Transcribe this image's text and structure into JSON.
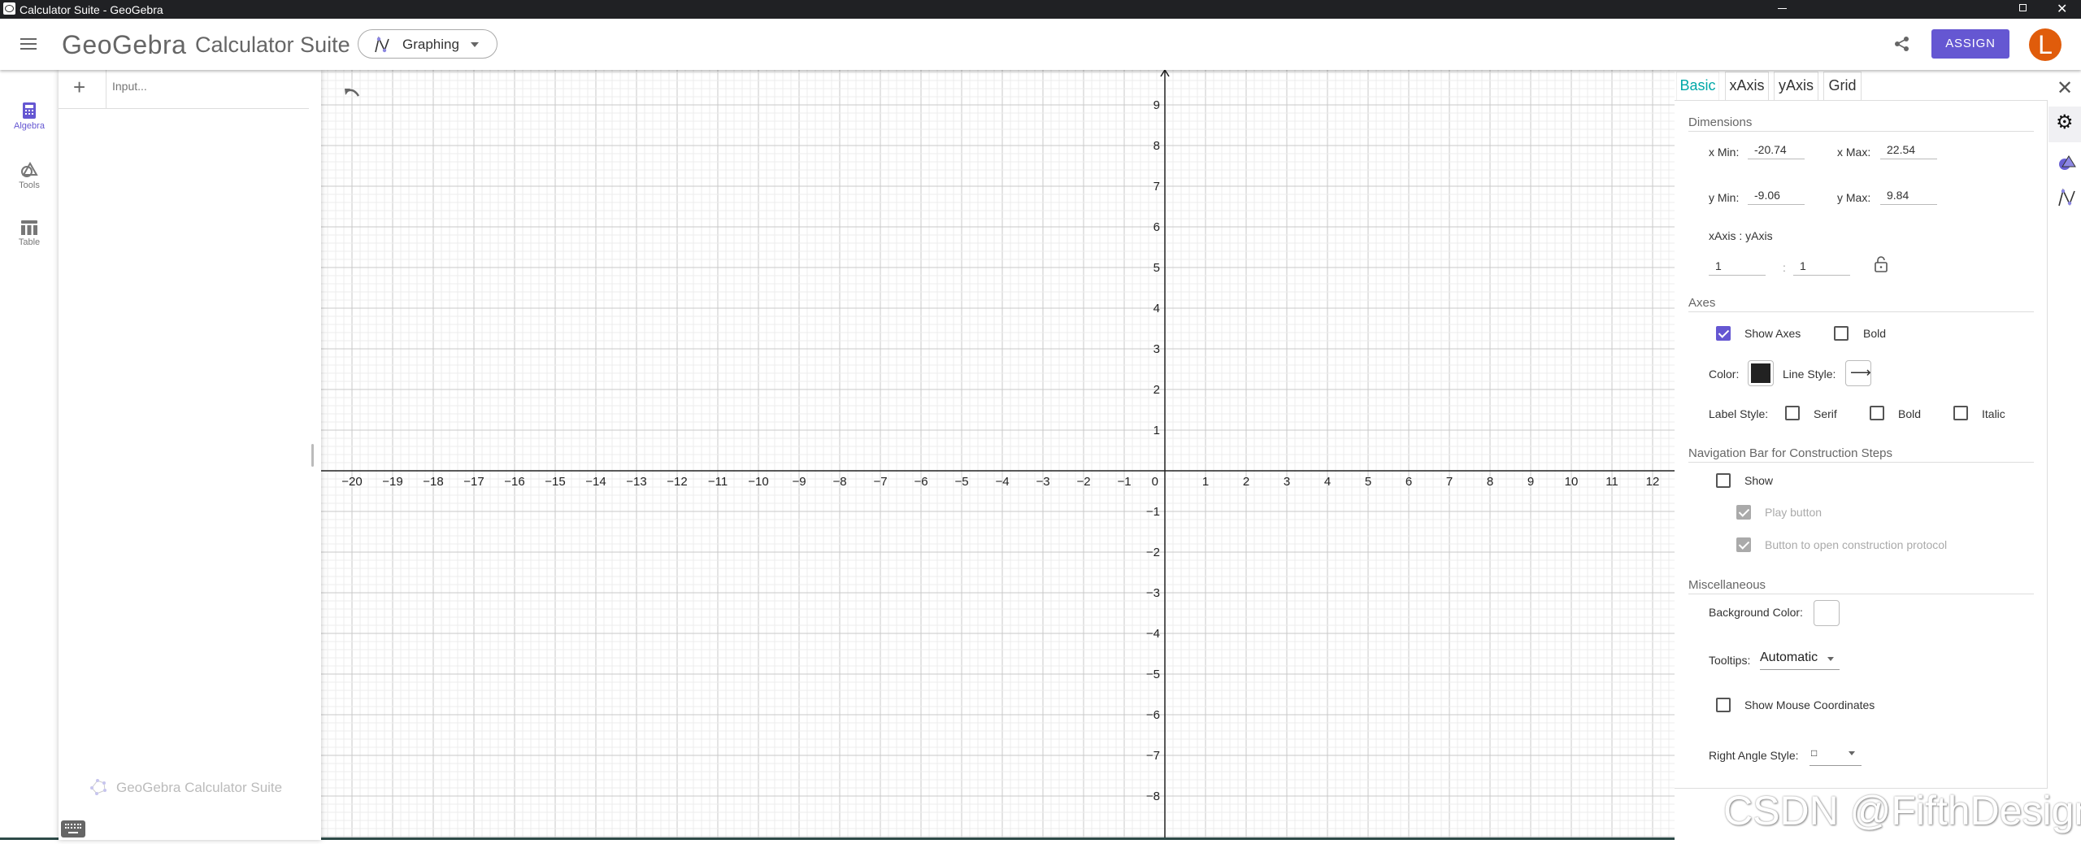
{
  "window": {
    "title": "Calculator Suite - GeoGebra"
  },
  "header": {
    "logo": "GeoGebra",
    "app_name": "Calculator Suite",
    "mode": "Graphing",
    "assign_label": "ASSIGN",
    "avatar_initial": "L",
    "accent": "#6557d2",
    "avatar_color": "#e05c0b"
  },
  "nav": {
    "items": [
      {
        "label": "Algebra",
        "active": true
      },
      {
        "label": "Tools"
      },
      {
        "label": "Table"
      }
    ]
  },
  "algebra": {
    "input_placeholder": "Input...",
    "footer": "GeoGebra Calculator Suite"
  },
  "graphics": {
    "x_ticks": [
      -20,
      -19,
      -18,
      -17,
      -16,
      -15,
      -14,
      -13,
      -12,
      -11,
      -10,
      -9,
      -8,
      -7,
      -6,
      -5,
      -4,
      -3,
      -2,
      -1,
      1,
      2,
      3,
      4,
      5,
      6,
      7,
      8,
      9,
      10,
      11,
      12
    ],
    "y_ticks": [
      -8,
      -7,
      -6,
      -5,
      -4,
      -3,
      -2,
      -1,
      1,
      2,
      3,
      4,
      5,
      6,
      7,
      8,
      9
    ],
    "origin_label": "0"
  },
  "settings": {
    "tabs": [
      "Basic",
      "xAxis",
      "yAxis",
      "Grid"
    ],
    "active_tab": "Basic",
    "dimensions": {
      "title": "Dimensions",
      "xmin_label": "x Min:",
      "xmin": "-20.74",
      "xmax_label": "x Max:",
      "xmax": "22.54",
      "ymin_label": "y Min:",
      "ymin": "-9.06",
      "ymax_label": "y Max:",
      "ymax": "9.84",
      "ratio_label": "xAxis : yAxis",
      "ratio_x": "1",
      "ratio_sep": ":",
      "ratio_y": "1"
    },
    "axes": {
      "title": "Axes",
      "show_axes": "Show Axes",
      "show_axes_checked": true,
      "bold": "Bold",
      "bold_checked": false,
      "color_label": "Color:",
      "axis_color": "#222222",
      "line_style_label": "Line Style:",
      "label_style": "Label Style:",
      "serif": "Serif",
      "bold2": "Bold",
      "italic": "Italic"
    },
    "navbar": {
      "title": "Navigation Bar for Construction Steps",
      "show": "Show",
      "play": "Play button",
      "protocol": "Button to open construction protocol"
    },
    "misc": {
      "title": "Miscellaneous",
      "bg_label": "Background Color:",
      "bg_color": "#ffffff",
      "tooltips_label": "Tooltips:",
      "tooltips_value": "Automatic",
      "mouse_coords": "Show Mouse Coordinates",
      "right_angle_label": "Right Angle Style:",
      "right_angle_value": "□"
    }
  },
  "watermark": "CSDN @FifthDesign"
}
